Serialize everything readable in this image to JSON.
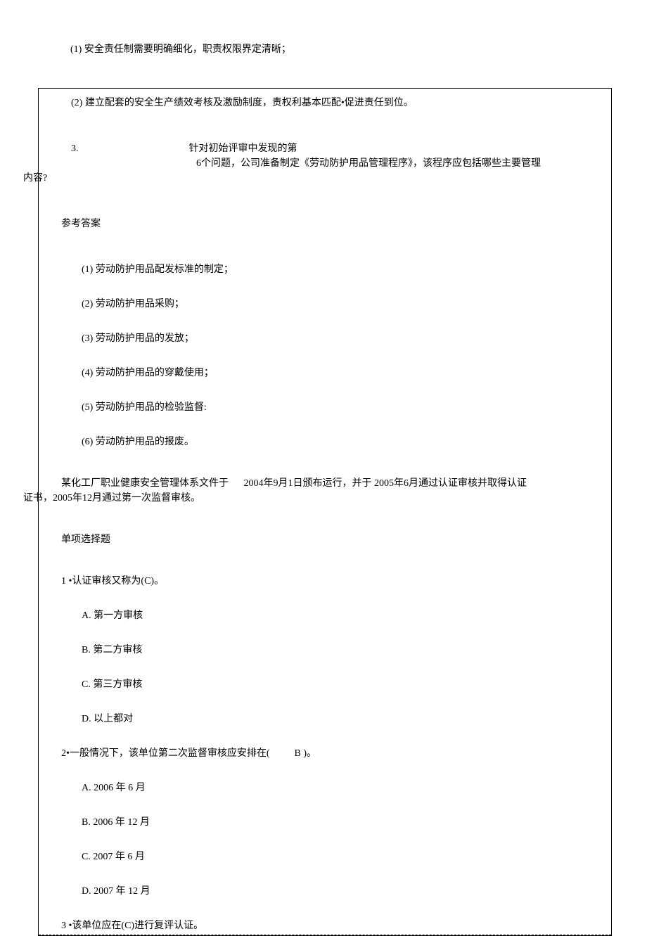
{
  "top": {
    "item1": "(1)  安全责任制需要明确细化，职责权限界定清晰；"
  },
  "box": {
    "item2": "(2)  建立配套的安全生产绩效考核及激励制度，责权利基本匹配•促进责任到位。",
    "q3_num": "3.",
    "q3_line1": "针对初始评审中发现的第",
    "q3_line2": "6个问题，公司准备制定《劳动防护用品管理程序》，该程序应包括哪些主要管理",
    "q3_suffix": "内容?",
    "ref": "参考答案",
    "a1": "(1)  劳动防护用品配发标准的制定；",
    "a2": "(2)  劳动防护用品采购；",
    "a3": "(3)  劳动防护用品的发放；",
    "a4": "(4)  劳动防护用品的穿戴使用；",
    "a5": "(5)  劳动防护用品的检验监督:",
    "a6": "(6)  劳动防护用品的报废。",
    "para1_a": "某化工厂职业健康安全管理体系文件于",
    "para1_b": "2004年9月1日颁布运行，并于  2005年6月通过认证审核并取得认证",
    "para2": "证书，2005年12月通过第一次监督审核。",
    "mcq_title": "单项选择题",
    "q1": "1 •认证审核又称为(C)。",
    "q1a": "A.  第一方审核",
    "q1b": "B.  第二方审核",
    "q1c": "C.  第三方审核",
    "q1d": "D.  以上都对",
    "q2_a": "2•一般情况下，该单位第二次监督审核应安排在(",
    "q2_b": "B )。",
    "q2a": "A.  2006 年  6 月",
    "q2b": "B.  2006 年  12 月",
    "q2c": "C.  2007 年  6 月",
    "q2d": "D.  2007 年  12 月",
    "q3last": "3 •该单位应在(C)进行复评认证。"
  }
}
